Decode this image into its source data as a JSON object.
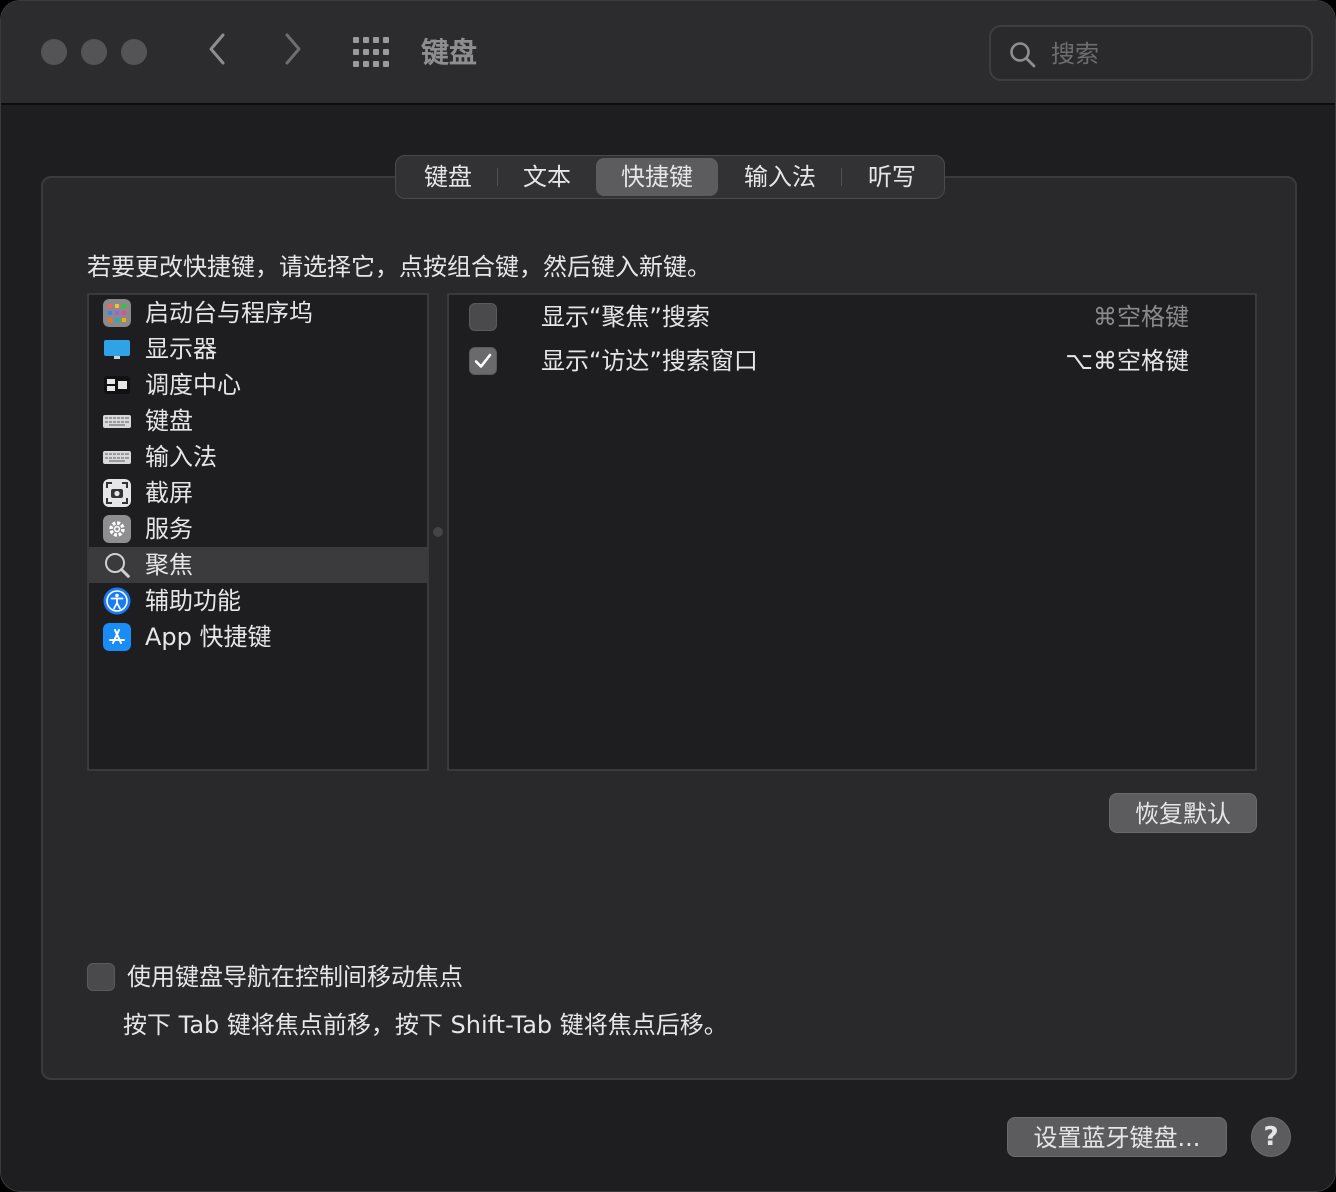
{
  "window": {
    "title": "键盘"
  },
  "search": {
    "placeholder": "搜索"
  },
  "tabs": [
    {
      "label": "键盘"
    },
    {
      "label": "文本"
    },
    {
      "label": "快捷键",
      "active": true
    },
    {
      "label": "输入法"
    },
    {
      "label": "听写"
    }
  ],
  "instruction": "若要更改快捷键，请选择它，点按组合键，然后键入新键。",
  "categories": [
    {
      "label": "启动台与程序坞",
      "icon": "launchpad-icon"
    },
    {
      "label": "显示器",
      "icon": "display-icon"
    },
    {
      "label": "调度中心",
      "icon": "mission-control-icon"
    },
    {
      "label": "键盘",
      "icon": "keyboard-icon"
    },
    {
      "label": "输入法",
      "icon": "keyboard-icon"
    },
    {
      "label": "截屏",
      "icon": "screenshot-icon"
    },
    {
      "label": "服务",
      "icon": "gear-icon"
    },
    {
      "label": "聚焦",
      "icon": "magnifier-icon",
      "selected": true
    },
    {
      "label": "辅助功能",
      "icon": "accessibility-icon"
    },
    {
      "label": "App 快捷键",
      "icon": "app-store-icon"
    }
  ],
  "shortcuts": [
    {
      "label": "显示“聚焦”搜索",
      "key": "⌘空格键",
      "checked": false
    },
    {
      "label": "显示“访达”搜索窗口",
      "key": "⌥⌘空格键",
      "checked": true
    }
  ],
  "restore_defaults": "恢复默认",
  "keyboard_nav": {
    "label": "使用键盘导航在控制间移动焦点",
    "checked": false,
    "description": "按下 Tab 键将焦点前移，按下 Shift-Tab 键将焦点后移。"
  },
  "bluetooth_button": "设置蓝牙键盘...",
  "help_label": "?",
  "colors": {
    "accessibility_blue": "#1a7cf5",
    "display_blue": "#2fa3e6",
    "selected_row": "#3b3b3d"
  }
}
